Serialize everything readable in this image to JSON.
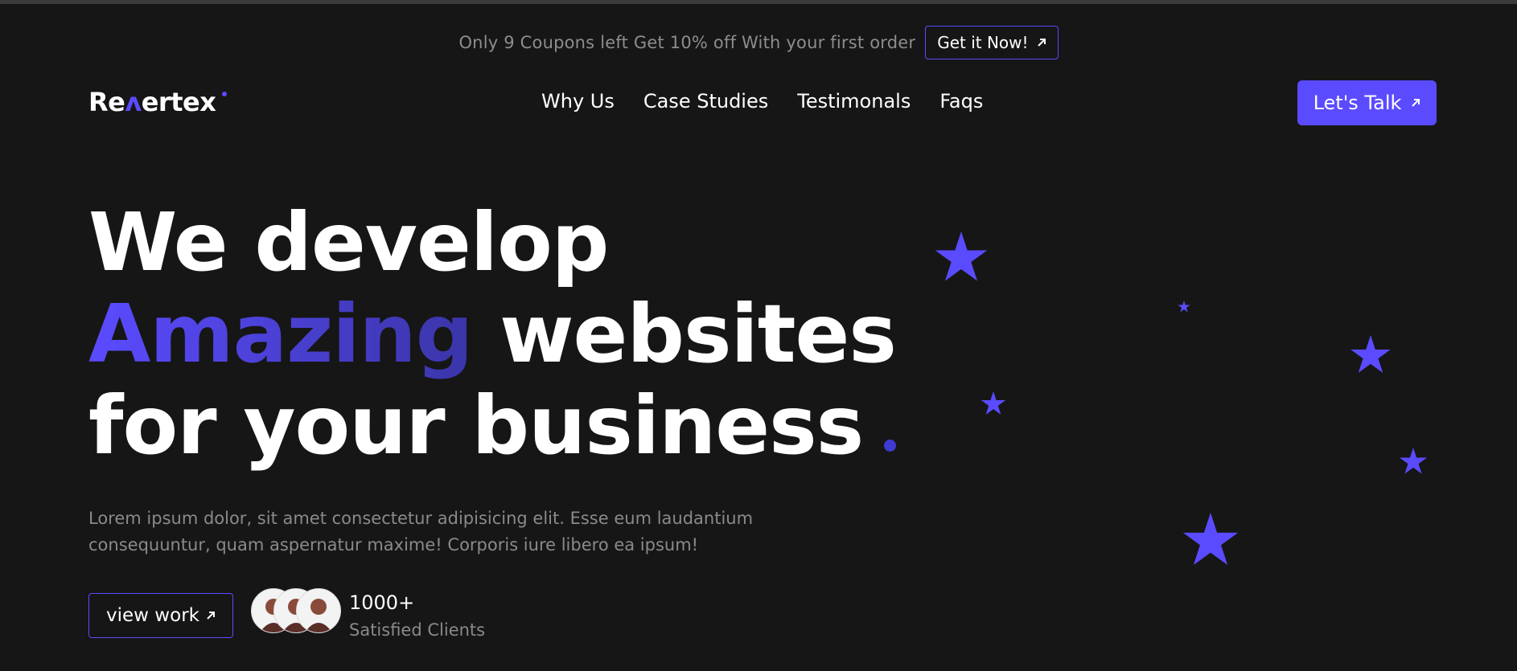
{
  "promo": {
    "text": "Only 9 Coupons left  Get 10% off With your first order",
    "button_label": "Get it Now!"
  },
  "brand": {
    "logo_text_a": "Re",
    "logo_caret": "ʌ",
    "logo_text_b": "ertex"
  },
  "nav": {
    "links": [
      "Why Us",
      "Case Studies",
      "Testimonals",
      "Faqs"
    ],
    "cta_label": "Let's Talk"
  },
  "hero": {
    "line1": "We develop",
    "line2_accent": "Amazing",
    "line2_rest": "websites",
    "line3": "for your business",
    "description": "Lorem ipsum dolor, sit amet consectetur adipisicing elit. Esse eum laudantium consequuntur, quam aspernatur maxime! Corporis iure libero ea ipsum!"
  },
  "actions": {
    "view_work_label": "view work"
  },
  "clients": {
    "count": "1000+",
    "label": "Satisfied Clients"
  },
  "colors": {
    "background": "#161616",
    "accent": "#5b4bff",
    "muted_text": "#8a8a8a"
  },
  "icons": {
    "arrow": "arrow-up-right-icon",
    "star": "star-icon"
  }
}
